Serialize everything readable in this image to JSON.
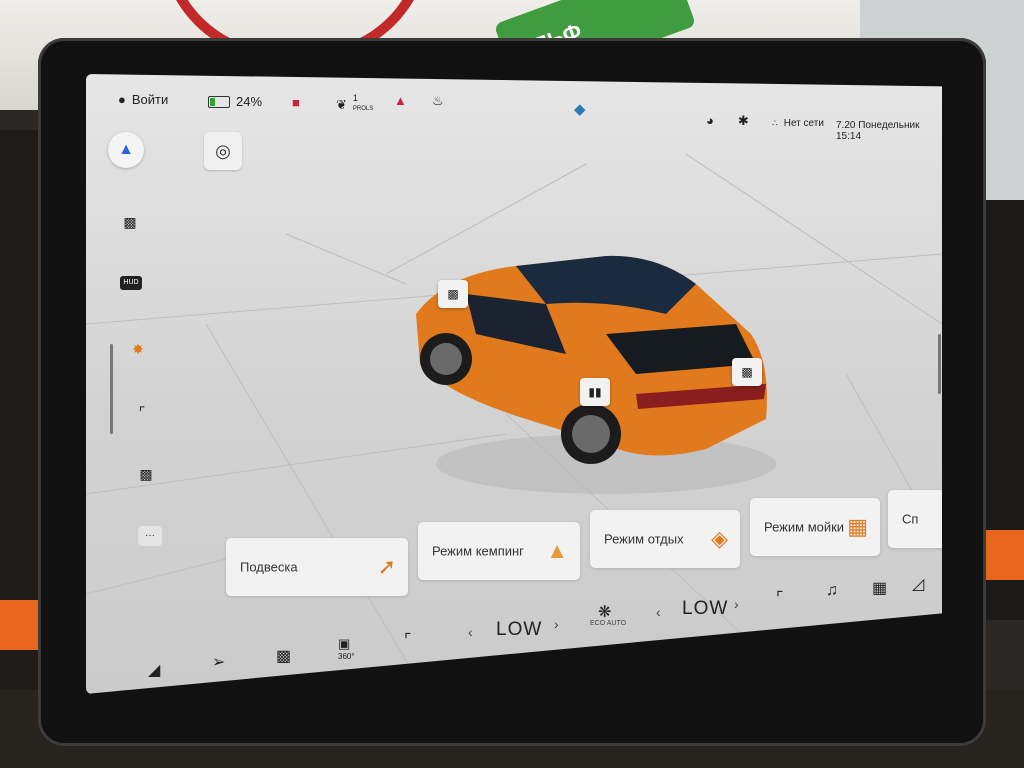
{
  "status_bar": {
    "user_label": "Войти",
    "battery_percent": "24%",
    "notification_count": "1",
    "notification_sub": "PROLS",
    "network_text": "Нет сети",
    "datetime_text": "7.20 Понедельник 15:14"
  },
  "sidebar": {
    "items": [
      "car-lights-icon",
      "hud-icon",
      "ambient-light-icon",
      "seat-icon",
      "car-doors-icon",
      "more-icon"
    ],
    "hud_label": "HUD",
    "more_label": "···"
  },
  "mode_cards": [
    {
      "label": "Подвеска",
      "icon": "suspension-icon"
    },
    {
      "label": "Режим кемпинг",
      "icon": "tent-icon"
    },
    {
      "label": "Режим отдых",
      "icon": "pillow-icon"
    },
    {
      "label": "Режим мойки",
      "icon": "sponge-icon"
    },
    {
      "label": "Сп",
      "icon": ""
    }
  ],
  "climate": {
    "fan_left_level": "LOW",
    "fan_right_level": "LOW",
    "eco_label": "ECO AUTO",
    "camera_label": "360°"
  },
  "colors": {
    "car_body": "#e07a1d",
    "accent_nav": "#2c63d8",
    "battery_fill": "#2aa72a",
    "alert_icon": "#c6283a"
  }
}
